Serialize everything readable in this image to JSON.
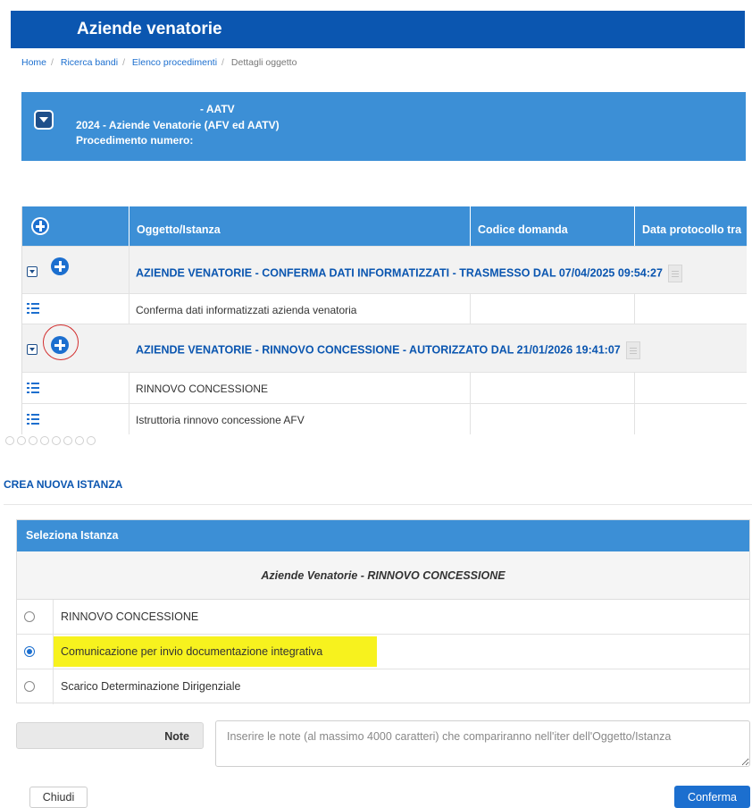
{
  "header": {
    "title": "Aziende venatorie"
  },
  "breadcrumb": [
    {
      "label": "Home"
    },
    {
      "label": "Ricerca bandi"
    },
    {
      "label": "Elenco procedimenti"
    },
    {
      "label": "Dettagli oggetto"
    }
  ],
  "procedimento": {
    "line1": "- AATV",
    "line2": "2024 - Aziende Venatorie (AFV ed AATV)",
    "line3": "Procedimento numero:",
    "toggle_icon": "chevron-down-square-icon"
  },
  "grid": {
    "columns": [
      "Oggetto/Istanza",
      "Codice domanda",
      "Data protocollo tra"
    ],
    "rows": [
      {
        "type": "group",
        "text": "AZIENDE VENATORIE - CONFERMA DATI INFORMATIZZATI - TRASMESSO DAL 07/04/2025 09:54:27"
      },
      {
        "type": "item",
        "text": "Conferma dati informatizzati azienda venatoria"
      },
      {
        "type": "group",
        "text": "AZIENDE VENATORIE - RINNOVO CONCESSIONE - AUTORIZZATO DAL 21/01/2026 19:41:07"
      },
      {
        "type": "item",
        "text": "RINNOVO CONCESSIONE"
      },
      {
        "type": "item",
        "text": "Istruttoria rinnovo concessione AFV"
      }
    ]
  },
  "crea": {
    "title": "CREA NUOVA ISTANZA"
  },
  "seleziona": {
    "header": "Seleziona Istanza",
    "subtitle": "Aziende Venatorie - RINNOVO CONCESSIONE",
    "options": [
      {
        "label": "RINNOVO CONCESSIONE",
        "selected": false
      },
      {
        "label": "Comunicazione per invio documentazione integrativa",
        "selected": true,
        "highlight": "#f7f21e"
      },
      {
        "label": "Scarico Determinazione Dirigenziale",
        "selected": false
      }
    ]
  },
  "note": {
    "label": "Note",
    "placeholder": "Inserire le note (al massimo 4000 caratteri) che compariranno nell'iter dell'Oggetto/Istanza",
    "value": ""
  },
  "buttons": {
    "close": "Chiudi",
    "confirm": "Conferma"
  },
  "colors": {
    "primary": "#0b56b0",
    "header_blue": "#3c8fd6",
    "highlight": "#f7f21e",
    "annotation": "#d32f2f"
  }
}
